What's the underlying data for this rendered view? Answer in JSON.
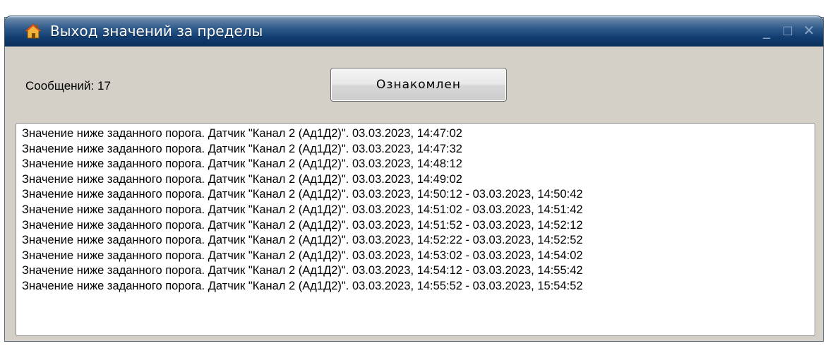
{
  "window": {
    "title": "Выход значений за пределы",
    "icon": "home-icon",
    "controls": {
      "minimize": "_",
      "maximize": "□",
      "close": "✕"
    }
  },
  "header": {
    "message_count_label": "Сообщений: 17",
    "acknowledge_button": "Ознакомлен"
  },
  "log": {
    "messages": [
      "Значение ниже заданного порога. Датчик \"Канал 2 (Ад1Д2)\". 03.03.2023, 14:47:02",
      "Значение ниже заданного порога. Датчик \"Канал 2 (Ад1Д2)\". 03.03.2023, 14:47:32",
      "Значение ниже заданного порога. Датчик \"Канал 2 (Ад1Д2)\". 03.03.2023, 14:48:12",
      "Значение ниже заданного порога. Датчик \"Канал 2 (Ад1Д2)\". 03.03.2023, 14:49:02",
      "Значение ниже заданного порога. Датчик \"Канал 2 (Ад1Д2)\". 03.03.2023, 14:50:12 - 03.03.2023, 14:50:42",
      "Значение ниже заданного порога. Датчик \"Канал 2 (Ад1Д2)\". 03.03.2023, 14:51:02 - 03.03.2023, 14:51:42",
      "Значение ниже заданного порога. Датчик \"Канал 2 (Ад1Д2)\". 03.03.2023, 14:51:52 - 03.03.2023, 14:52:12",
      "Значение ниже заданного порога. Датчик \"Канал 2 (Ад1Д2)\". 03.03.2023, 14:52:22 - 03.03.2023, 14:52:52",
      "Значение ниже заданного порога. Датчик \"Канал 2 (Ад1Д2)\". 03.03.2023, 14:53:02 - 03.03.2023, 14:54:02",
      "Значение ниже заданного порога. Датчик \"Канал 2 (Ад1Д2)\". 03.03.2023, 14:54:12 - 03.03.2023, 14:55:42",
      "Значение ниже заданного порога. Датчик \"Канал 2 (Ад1Д2)\". 03.03.2023, 14:55:52 - 03.03.2023, 15:54:52"
    ]
  },
  "colors": {
    "titlebar_dark": "#0a2f5c",
    "titlebar_light": "#2f5b8c",
    "window_bg": "#d4d0c8",
    "title_text": "#ffffff"
  }
}
